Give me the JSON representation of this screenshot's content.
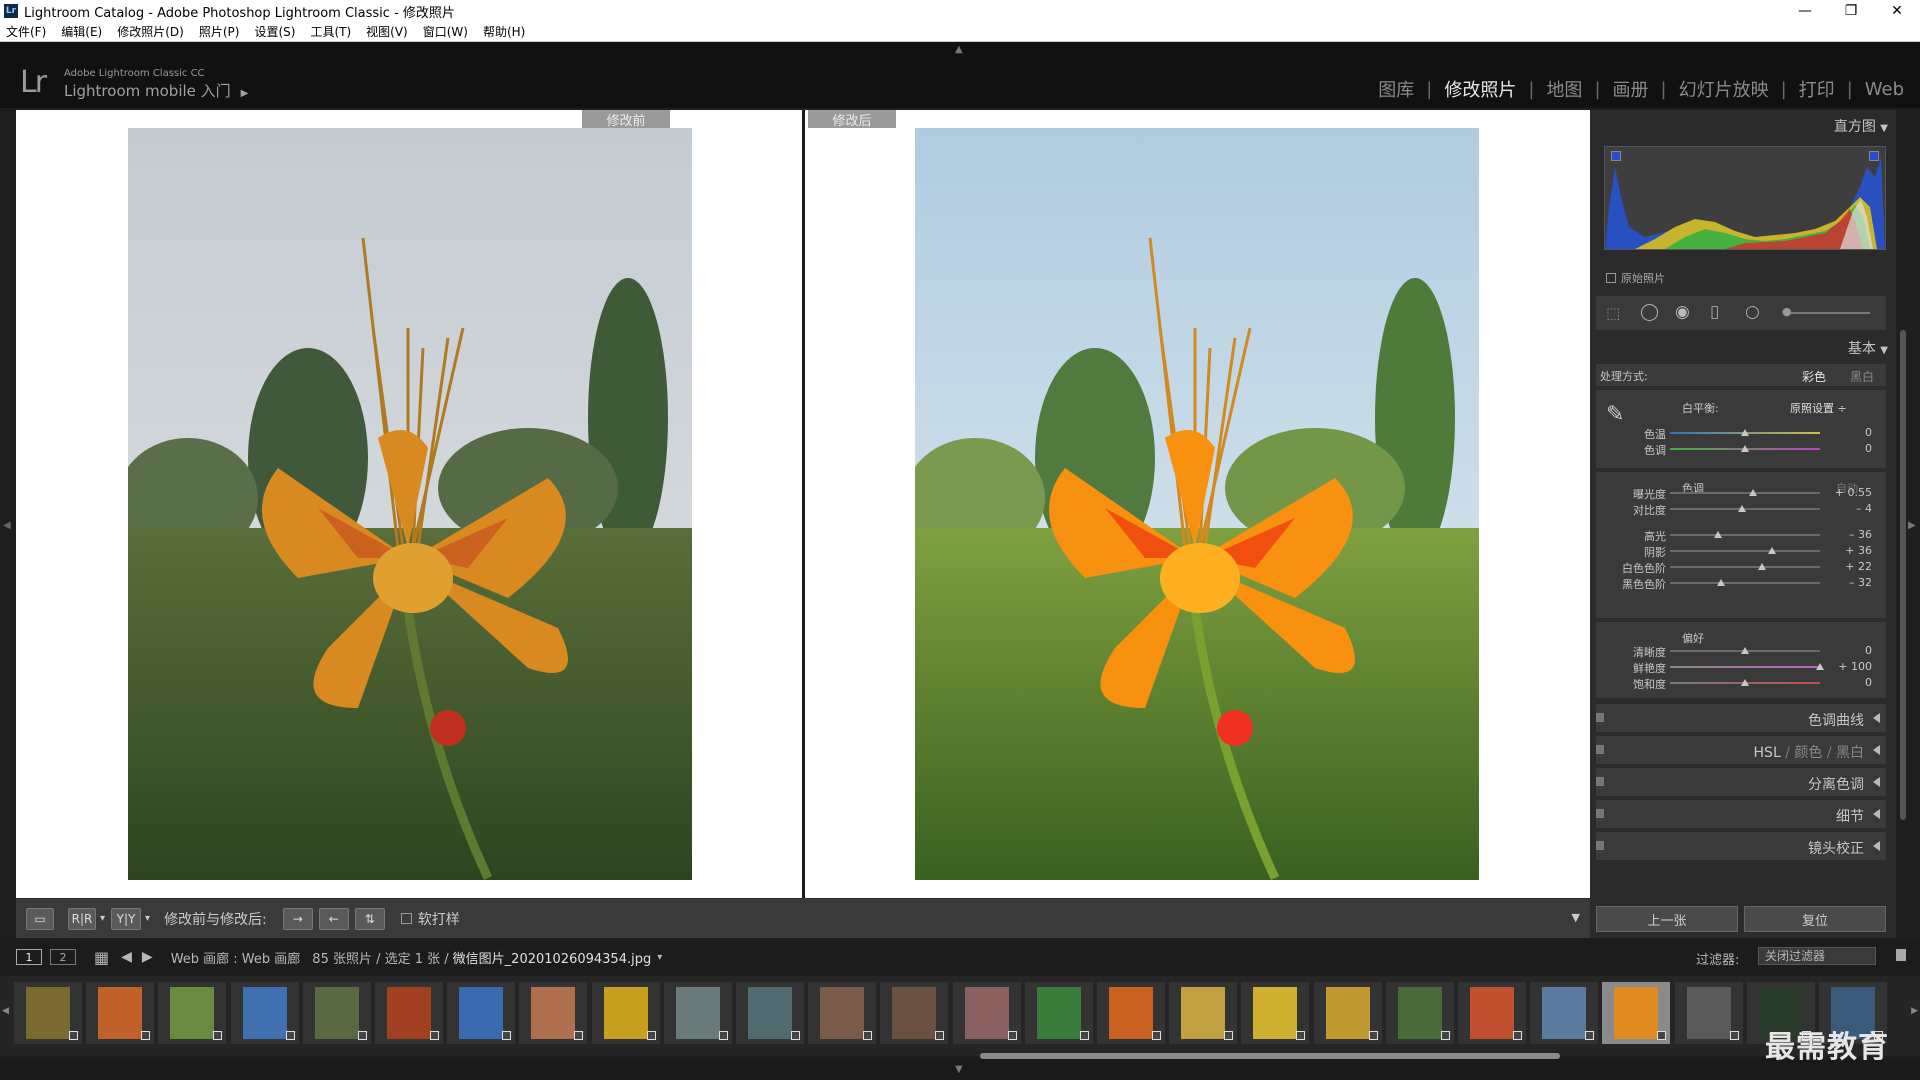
{
  "window": {
    "title": "Lightroom Catalog - Adobe Photoshop Lightroom Classic - 修改照片",
    "min": "—",
    "restore": "❐",
    "close": "✕"
  },
  "menu": [
    "文件(F)",
    "编辑(E)",
    "修改照片(D)",
    "照片(P)",
    "设置(S)",
    "工具(T)",
    "视图(V)",
    "窗口(W)",
    "帮助(H)"
  ],
  "brand": {
    "logo": "Lr",
    "small": "Adobe Lightroom Classic CC",
    "main": "Lightroom mobile 入门",
    "caret": "▶"
  },
  "modules": [
    {
      "label": "图库",
      "active": false
    },
    {
      "label": "修改照片",
      "active": true
    },
    {
      "label": "地图",
      "active": false
    },
    {
      "label": "画册",
      "active": false
    },
    {
      "label": "幻灯片放映",
      "active": false
    },
    {
      "label": "打印",
      "active": false
    },
    {
      "label": "Web",
      "active": false
    }
  ],
  "compare": {
    "before": "修改前",
    "after": "修改后"
  },
  "toolbar": {
    "mode_label": "修改前与修改后:",
    "softproof": "软打样",
    "dropdown": "▾"
  },
  "panel": {
    "histogram": "直方图",
    "original": "原始照片",
    "basic": "基本",
    "treatment_label": "处理方式:",
    "color": "彩色",
    "bw": "黑白",
    "wb_label": "白平衡:",
    "wb_value": "原照设置",
    "tone_title": "色调",
    "auto": "自动",
    "presence_title": "偏好",
    "sliders": {
      "temp": {
        "label": "色温",
        "value": "0",
        "pos": 0.5
      },
      "tint": {
        "label": "色调",
        "value": "0",
        "pos": 0.5
      },
      "exposure": {
        "label": "曝光度",
        "value": "+ 0.55",
        "pos": 0.555
      },
      "contrast": {
        "label": "对比度",
        "value": "– 4",
        "pos": 0.48
      },
      "highlights": {
        "label": "高光",
        "value": "– 36",
        "pos": 0.32
      },
      "shadows": {
        "label": "阴影",
        "value": "+ 36",
        "pos": 0.68
      },
      "whites": {
        "label": "白色色阶",
        "value": "+ 22",
        "pos": 0.61
      },
      "blacks": {
        "label": "黑色色阶",
        "value": "– 32",
        "pos": 0.34
      },
      "clarity": {
        "label": "清晰度",
        "value": "0",
        "pos": 0.5
      },
      "vibrance": {
        "label": "鲜艳度",
        "value": "+ 100",
        "pos": 1.0
      },
      "saturation": {
        "label": "饱和度",
        "value": "0",
        "pos": 0.5
      }
    },
    "sections": {
      "curve": "色调曲线",
      "hsl": "HSL",
      "hsl_color": "颜色",
      "hsl_bw": "黑白",
      "split": "分离色调",
      "detail": "细节",
      "lens": "镜头校正"
    },
    "prev": "上一张",
    "reset": "复位"
  },
  "filmbar": {
    "v1": "1",
    "v2": "2",
    "source": "Web 画廊 : Web 画廊",
    "count": "85 张照片 / 选定 1 张 /",
    "filename": "微信图片_20201026094354.jpg",
    "filter_label": "过滤器:",
    "filter_value": "关闭过滤器"
  },
  "thumbs": [
    "#7a6a30",
    "#c0602a",
    "#6a8a40",
    "#4070b0",
    "#5a6a40",
    "#a04020",
    "#3a6ab0",
    "#b07050",
    "#c8a020",
    "#6a7a7a",
    "#506a70",
    "#7a5a4a",
    "#6a5040",
    "#8a6060",
    "#3a7a3a",
    "#c86020",
    "#c0a040",
    "#d0b030",
    "#c09a30",
    "#4a6a3a",
    "#c05030",
    "#5a7aa0",
    "#e08a20",
    "#5a5a5a",
    "#2a3a2a",
    "#3a5a7a"
  ],
  "watermark": "最需教育"
}
